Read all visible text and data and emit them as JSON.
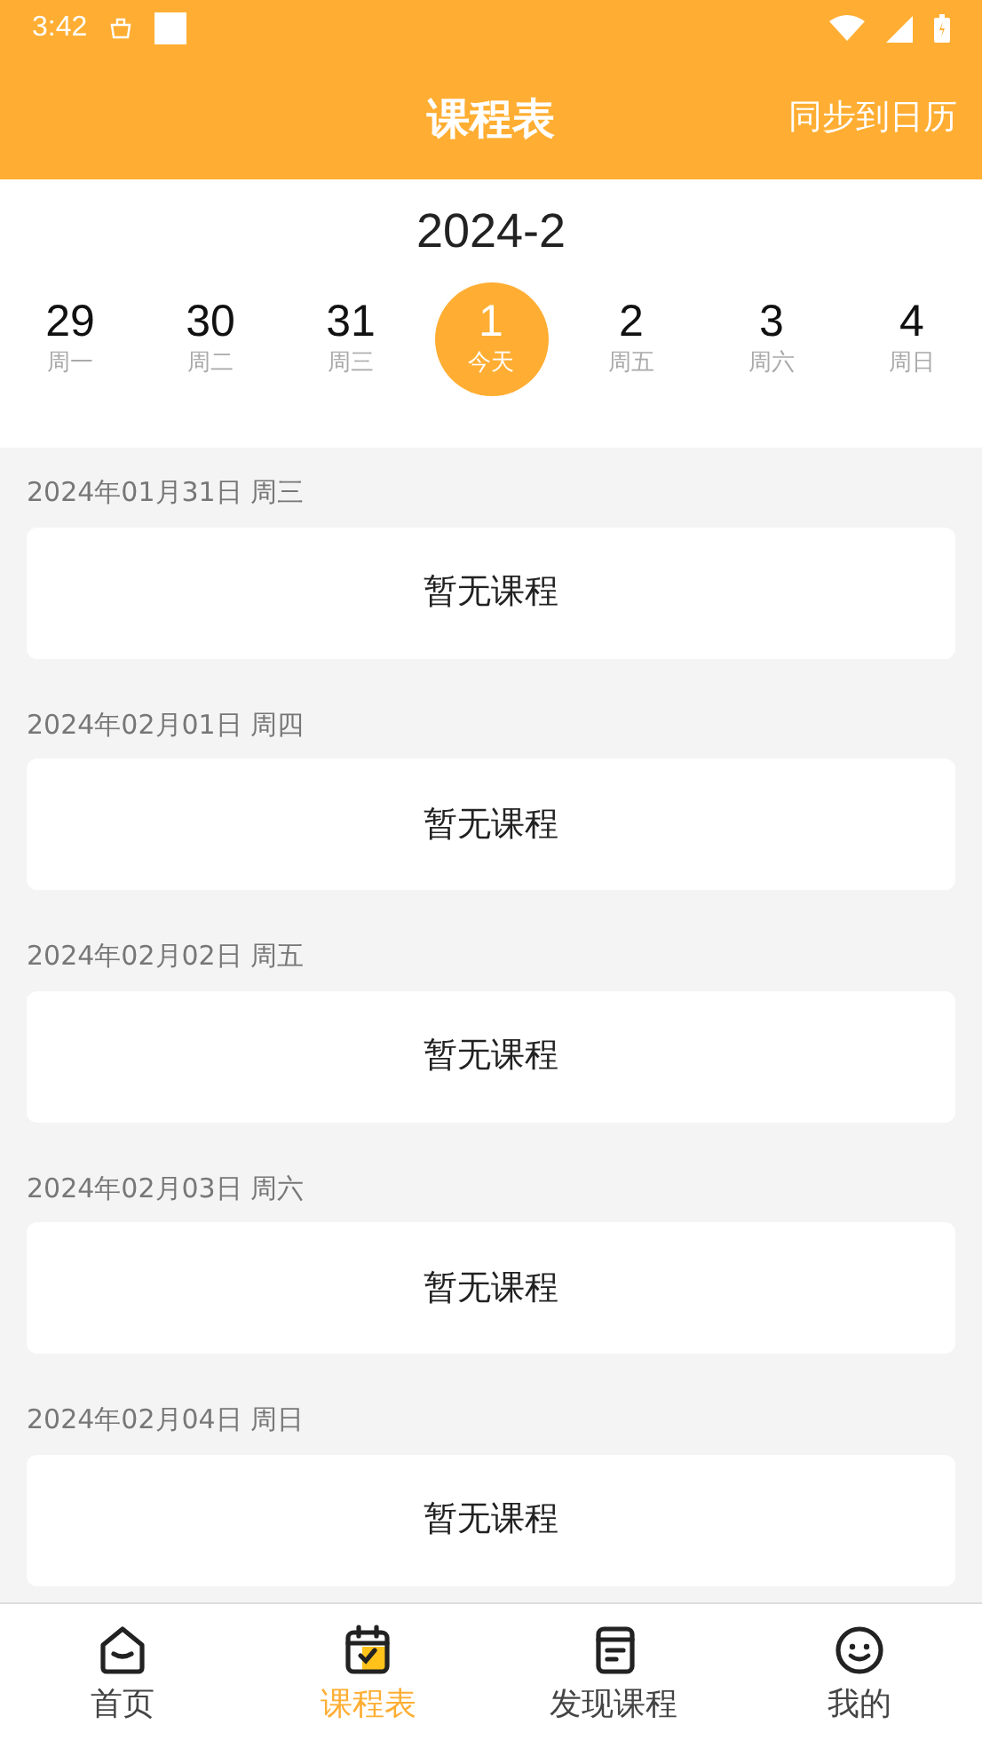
{
  "status_bar": {
    "time": "3:42"
  },
  "header": {
    "title": "课程表",
    "action": "同步到日历"
  },
  "month": "2024-2",
  "week": [
    {
      "day": "29",
      "label": "周一",
      "selected": false
    },
    {
      "day": "30",
      "label": "周二",
      "selected": false
    },
    {
      "day": "31",
      "label": "周三",
      "selected": false
    },
    {
      "day": "1",
      "label": "今天",
      "selected": true
    },
    {
      "day": "2",
      "label": "周五",
      "selected": false
    },
    {
      "day": "3",
      "label": "周六",
      "selected": false
    },
    {
      "day": "4",
      "label": "周日",
      "selected": false
    }
  ],
  "schedule": [
    {
      "date": "2024年01月31日 周三",
      "content": "暂无课程"
    },
    {
      "date": "2024年02月01日 周四",
      "content": "暂无课程"
    },
    {
      "date": "2024年02月02日 周五",
      "content": "暂无课程"
    },
    {
      "date": "2024年02月03日 周六",
      "content": "暂无课程"
    },
    {
      "date": "2024年02月04日 周日",
      "content": "暂无课程"
    }
  ],
  "tab_bar": [
    {
      "label": "首页",
      "kind": "home",
      "selected": false
    },
    {
      "label": "课程表",
      "kind": "calendar",
      "selected": true
    },
    {
      "label": "发现课程",
      "kind": "book",
      "selected": false
    },
    {
      "label": "我的",
      "kind": "profile",
      "selected": false
    }
  ]
}
